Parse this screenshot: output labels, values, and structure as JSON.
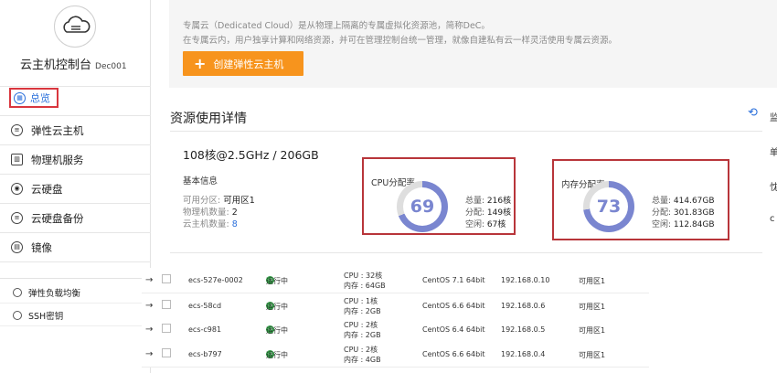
{
  "sidebar": {
    "console_title": "云主机控制台",
    "console_id": "Dec001",
    "overview_label": "总览",
    "items": [
      {
        "label": "弹性云主机"
      },
      {
        "label": "物理机服务"
      },
      {
        "label": "云硬盘"
      },
      {
        "label": "云硬盘备份"
      },
      {
        "label": "镜像"
      }
    ],
    "sub_items": [
      {
        "label": "弹性负载均衡"
      },
      {
        "label": "SSH密钥"
      }
    ]
  },
  "info": {
    "line1": "专属云（Dedicated Cloud）是从物理上隔离的专属虚拟化资源池，简称DeC。",
    "line2": "在专属云内，用户独享计算和网络资源，并可在管理控制台统一管理，就像自建私有云一样灵活使用专属云资源。",
    "create_button": "创建弹性云主机"
  },
  "resources": {
    "title": "资源使用详情",
    "spec": "108核@2.5GHz / 206GB",
    "basic_title": "基本信息",
    "basic": [
      {
        "label": "可用分区: ",
        "value": "可用区1"
      },
      {
        "label": "物理机数量: ",
        "value": "2"
      },
      {
        "label": "云主机数量: ",
        "value": "8"
      }
    ],
    "right_strip": [
      "监",
      "单",
      "忱",
      "c"
    ]
  },
  "cpu": {
    "title": "CPU分配率",
    "percent": "69",
    "rows": [
      {
        "label": "总量: ",
        "value": "216核"
      },
      {
        "label": "分配: ",
        "value": "149核"
      },
      {
        "label": "空闲: ",
        "value": "67核"
      }
    ]
  },
  "memory": {
    "title": "内存分配率",
    "percent": "73",
    "rows": [
      {
        "label": "总量: ",
        "value": "414.67GB"
      },
      {
        "label": "分配: ",
        "value": "301.83GB"
      },
      {
        "label": "空闲: ",
        "value": "112.84GB"
      }
    ]
  },
  "table": {
    "rows": [
      {
        "name": "ecs-527e-0002",
        "status": "运行中",
        "cpu": "CPU : 32核",
        "mem": "内存 : 64GB",
        "os": "CentOS 7.1 64bit",
        "ip": "192.168.0.10",
        "zone": "可用区1"
      },
      {
        "name": "ecs-58cd",
        "status": "运行中",
        "cpu": "CPU : 1核",
        "mem": "内存 : 2GB",
        "os": "CentOS 6.6 64bit",
        "ip": "192.168.0.6",
        "zone": "可用区1"
      },
      {
        "name": "ecs-c981",
        "status": "运行中",
        "cpu": "CPU : 2核",
        "mem": "内存 : 2GB",
        "os": "CentOS 6.4 64bit",
        "ip": "192.168.0.5",
        "zone": "可用区1"
      },
      {
        "name": "ecs-b797",
        "status": "运行中",
        "cpu": "CPU : 2核",
        "mem": "内存 : 4GB",
        "os": "CentOS 6.6 64bit",
        "ip": "192.168.0.4",
        "zone": "可用区1"
      }
    ]
  },
  "colors": {
    "accent_blue": "#2a6fdb",
    "orange": "#f7941d",
    "highlight_red": "#d9363e",
    "gauge": "#7a86d0",
    "running_green": "#2f9e44"
  }
}
